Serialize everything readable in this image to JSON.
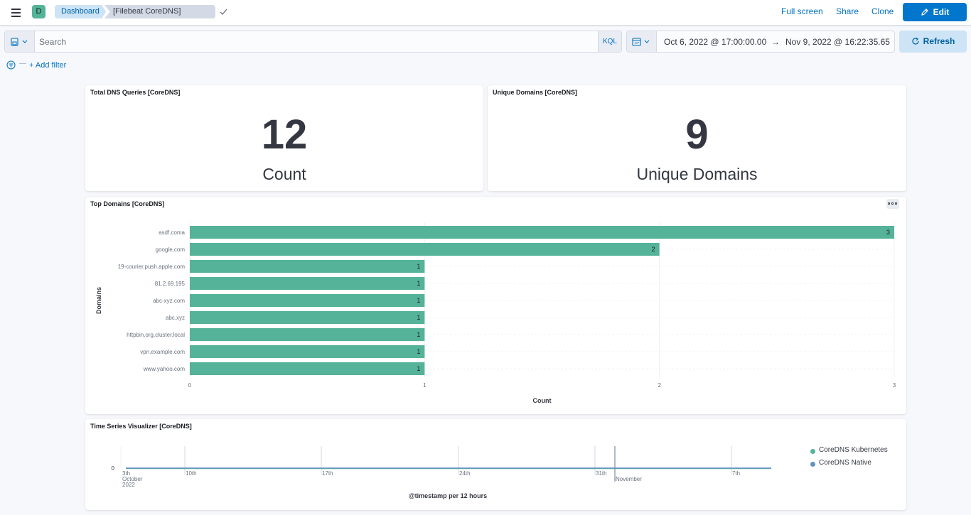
{
  "header": {
    "avatar_letter": "D",
    "breadcrumbs": [
      "Dashboard",
      "[Filebeat CoreDNS] Overview"
    ],
    "actions": {
      "full_screen": "Full screen",
      "share": "Share",
      "clone": "Clone",
      "edit": "Edit"
    }
  },
  "query": {
    "search_placeholder": "Search",
    "language": "KQL",
    "date_start": "Oct 6, 2022 @ 17:00:00.00",
    "date_arrow": "→",
    "date_end": "Nov 9, 2022 @ 16:22:35.65",
    "refresh_label": "Refresh",
    "add_filter_label": "+ Add filter"
  },
  "panels": {
    "total_queries": {
      "title": "Total DNS Queries [CoreDNS]",
      "value": "12",
      "label": "Count"
    },
    "unique_domains": {
      "title": "Unique Domains [CoreDNS]",
      "value": "9",
      "label": "Unique Domains"
    },
    "top_domains": {
      "title": "Top Domains [CoreDNS]"
    },
    "time_series": {
      "title": "Time Series Visualizer [CoreDNS]"
    }
  },
  "colors": {
    "accent": "#0077cc",
    "bar": "#54b399",
    "series_native": "#6092c0"
  },
  "chart_data": [
    {
      "type": "bar",
      "orientation": "horizontal",
      "categories": [
        "asdf.coma",
        "google.com",
        "19-courier.push.apple.com",
        "81.2.69.195",
        "abc-xyz.com",
        "abc.xyz",
        "httpbin.org.cluster.local",
        "vpn.example.com",
        "www.yahoo.com"
      ],
      "values": [
        3,
        2,
        1,
        1,
        1,
        1,
        1,
        1,
        1
      ],
      "xlabel": "Count",
      "ylabel": "Domains",
      "xlim": [
        0,
        3
      ],
      "xticks": [
        "0",
        "1",
        "2",
        "3"
      ],
      "grid": true,
      "data_labels": true
    },
    {
      "type": "line",
      "xlabel": "@timestamp per 12 hours",
      "ylabel": "",
      "yticks": [
        "0"
      ],
      "xticks": [
        {
          "label": "3th",
          "sub": [
            "October",
            "2022"
          ]
        },
        {
          "label": "10th"
        },
        {
          "label": "17th"
        },
        {
          "label": "24th"
        },
        {
          "label": "31th"
        },
        {
          "label": "November"
        },
        {
          "label": "7th"
        }
      ],
      "series": [
        {
          "name": "CoreDNS Kubernetes",
          "color": "#54b399",
          "values": [
            0
          ]
        },
        {
          "name": "CoreDNS Native",
          "color": "#6092c0",
          "values": [
            0
          ]
        }
      ],
      "legend": "right"
    }
  ]
}
